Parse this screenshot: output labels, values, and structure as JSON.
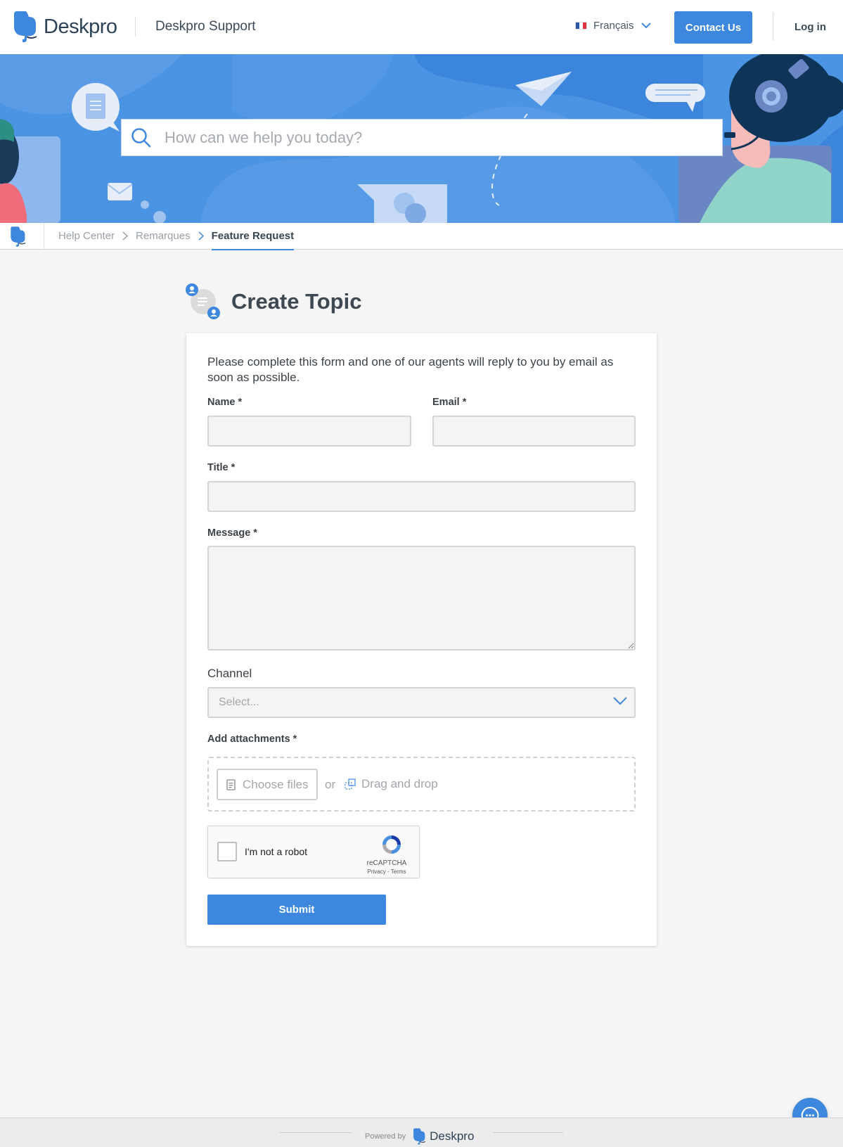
{
  "header": {
    "brand": "Deskpro",
    "site_name": "Deskpro Support",
    "language": "Français",
    "contact_label": "Contact Us",
    "login_label": "Log in"
  },
  "search": {
    "placeholder": "How can we help you today?"
  },
  "breadcrumb": {
    "items": [
      "Help Center",
      "Remarques",
      "Feature Request"
    ]
  },
  "page": {
    "title": "Create Topic"
  },
  "form": {
    "intro": "Please complete this form and one of our agents will reply to you by email as soon as possible.",
    "name_label": "Name *",
    "email_label": "Email *",
    "title_label": "Title *",
    "message_label": "Message *",
    "channel_label": "Channel",
    "channel_placeholder": "Select...",
    "attachments_label": "Add attachments *",
    "choose_files": "Choose files",
    "or": "or",
    "drag_drop": "Drag and drop",
    "captcha_text": "I'm not a robot",
    "captcha_brand": "reCAPTCHA",
    "captcha_links": "Privacy - Terms",
    "submit_label": "Submit"
  },
  "footer": {
    "powered_by": "Powered by",
    "brand": "Deskpro"
  },
  "colors": {
    "accent": "#3d88de",
    "hero": "#4b93e3"
  }
}
